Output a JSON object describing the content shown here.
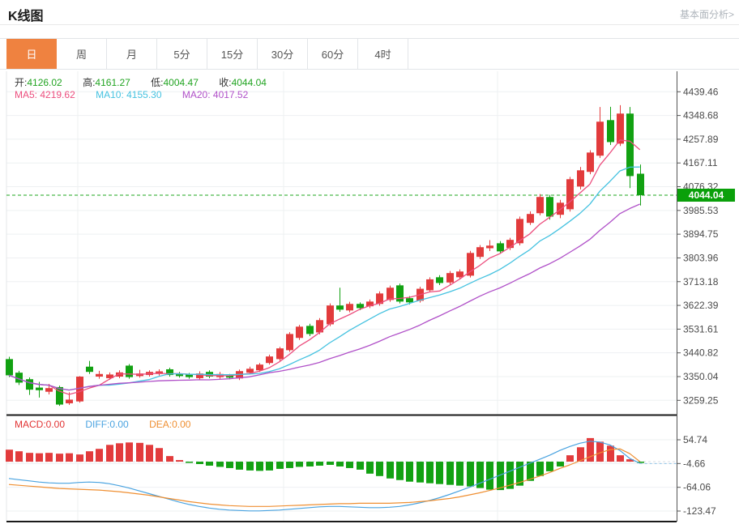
{
  "header": {
    "title": "K线图",
    "link_label": "基本面分析>"
  },
  "tabs": {
    "items": [
      "日",
      "周",
      "月",
      "5分",
      "15分",
      "30分",
      "60分",
      "4时"
    ],
    "active_index": 0
  },
  "ohlc": [
    {
      "label": "开:",
      "value": "4126.02"
    },
    {
      "label": "高:",
      "value": "4161.27"
    },
    {
      "label": "低:",
      "value": "4004.47"
    },
    {
      "label": "收:",
      "value": "4044.04"
    }
  ],
  "ma_legend": [
    {
      "label": "MA5:",
      "value": "4219.62"
    },
    {
      "label": "MA10:",
      "value": "4155.30"
    },
    {
      "label": "MA20:",
      "value": "4017.52"
    }
  ],
  "macd_legend": [
    {
      "label": "MACD:",
      "value": "0.00"
    },
    {
      "label": "DIFF:",
      "value": "0.00"
    },
    {
      "label": "DEA:",
      "value": "0.00"
    }
  ],
  "current_price_label": "4044.04",
  "colors": {
    "up": "#e23b3c",
    "down": "#12a112",
    "ma5": "#ec4e7e",
    "ma10": "#45c2e0",
    "ma20": "#b050c8",
    "diff": "#4aa3e0",
    "dea": "#ef8f32",
    "tab_active": "#ef8240",
    "price_badge": "#0aa00a",
    "grid": "#eef0f2",
    "axis": "#555555",
    "axis_label": "#4a4a4a",
    "price_line": "#1ea51e",
    "dark_rule": "#1a1a1a"
  },
  "chart_data": {
    "type": "candlestick",
    "title": "K线图",
    "period": "日",
    "legend_position": "top-left",
    "grid": true,
    "y_axis_ticks": [
      4439.46,
      4348.68,
      4257.89,
      4167.11,
      4076.32,
      3985.53,
      3894.75,
      3803.96,
      3713.18,
      3622.39,
      3531.61,
      3440.82,
      3350.04,
      3259.25
    ],
    "current_price": 4044.04,
    "ma_periods": [
      5,
      10,
      20
    ],
    "candles": [
      [
        3417,
        3426,
        3348,
        3355
      ],
      [
        3365,
        3372,
        3318,
        3327
      ],
      [
        3340,
        3347,
        3280,
        3300
      ],
      [
        3308,
        3330,
        3270,
        3298
      ],
      [
        3292,
        3322,
        3282,
        3306
      ],
      [
        3310,
        3315,
        3238,
        3243
      ],
      [
        3248,
        3290,
        3242,
        3262
      ],
      [
        3255,
        3352,
        3250,
        3350
      ],
      [
        3388,
        3410,
        3360,
        3368
      ],
      [
        3350,
        3372,
        3342,
        3360
      ],
      [
        3344,
        3366,
        3338,
        3358
      ],
      [
        3350,
        3374,
        3344,
        3366
      ],
      [
        3392,
        3398,
        3342,
        3348
      ],
      [
        3352,
        3376,
        3346,
        3362
      ],
      [
        3356,
        3374,
        3350,
        3368
      ],
      [
        3360,
        3378,
        3354,
        3370
      ],
      [
        3378,
        3384,
        3350,
        3356
      ],
      [
        3362,
        3368,
        3346,
        3352
      ],
      [
        3358,
        3364,
        3342,
        3348
      ],
      [
        3344,
        3370,
        3338,
        3362
      ],
      [
        3368,
        3374,
        3344,
        3350
      ],
      [
        3348,
        3368,
        3342,
        3360
      ],
      [
        3354,
        3360,
        3340,
        3346
      ],
      [
        3343,
        3377,
        3337,
        3371
      ],
      [
        3365,
        3388,
        3358,
        3380
      ],
      [
        3374,
        3402,
        3368,
        3396
      ],
      [
        3402,
        3434,
        3396,
        3427
      ],
      [
        3417,
        3464,
        3410,
        3458
      ],
      [
        3451,
        3520,
        3445,
        3513
      ],
      [
        3498,
        3548,
        3490,
        3541
      ],
      [
        3544,
        3552,
        3505,
        3513
      ],
      [
        3519,
        3574,
        3512,
        3566
      ],
      [
        3550,
        3630,
        3543,
        3622
      ],
      [
        3622,
        3690,
        3598,
        3606
      ],
      [
        3603,
        3636,
        3596,
        3628
      ],
      [
        3628,
        3634,
        3604,
        3612
      ],
      [
        3619,
        3645,
        3612,
        3637
      ],
      [
        3628,
        3676,
        3621,
        3668
      ],
      [
        3643,
        3698,
        3636,
        3690
      ],
      [
        3699,
        3706,
        3630,
        3637
      ],
      [
        3650,
        3658,
        3626,
        3634
      ],
      [
        3640,
        3694,
        3633,
        3686
      ],
      [
        3680,
        3730,
        3672,
        3722
      ],
      [
        3730,
        3738,
        3700,
        3708
      ],
      [
        3710,
        3754,
        3702,
        3746
      ],
      [
        3730,
        3760,
        3722,
        3752
      ],
      [
        3736,
        3831,
        3729,
        3823
      ],
      [
        3808,
        3853,
        3800,
        3845
      ],
      [
        3841,
        3872,
        3830,
        3851
      ],
      [
        3860,
        3868,
        3820,
        3829
      ],
      [
        3842,
        3881,
        3834,
        3873
      ],
      [
        3860,
        3962,
        3852,
        3953
      ],
      [
        3938,
        3982,
        3930,
        3972
      ],
      [
        3975,
        4048,
        3967,
        4037
      ],
      [
        4037,
        4045,
        3950,
        3962
      ],
      [
        3969,
        4026,
        3956,
        4015
      ],
      [
        3990,
        4114,
        3981,
        4105
      ],
      [
        4077,
        4152,
        4066,
        4139
      ],
      [
        4133,
        4216,
        4124,
        4207
      ],
      [
        4195,
        4381,
        4186,
        4325
      ],
      [
        4331,
        4382,
        4236,
        4247
      ],
      [
        4241,
        4388,
        4232,
        4356
      ],
      [
        4356,
        4381,
        4071,
        4117
      ],
      [
        4126.02,
        4161.27,
        4004.47,
        4044.04
      ]
    ],
    "macd": {
      "ticks": [
        54.74,
        -4.66,
        -64.06,
        -123.47
      ],
      "histogram": [
        30,
        26,
        22,
        21,
        22,
        20,
        21,
        18,
        26,
        32,
        42,
        46,
        48,
        47,
        42,
        34,
        14,
        4,
        -3,
        -6,
        -10,
        -13,
        -16,
        -20,
        -22,
        -23,
        -22,
        -18,
        -16,
        -13,
        -12,
        -10,
        -8,
        -12,
        -16,
        -20,
        -30,
        -36,
        -42,
        -46,
        -50,
        -52,
        -54,
        -56,
        -58,
        -60,
        -62,
        -66,
        -70,
        -71,
        -68,
        -60,
        -48,
        -36,
        -24,
        -12,
        16,
        36,
        59,
        50,
        40,
        16,
        6,
        -1
      ],
      "diff": [
        -42,
        -45,
        -48,
        -51,
        -53,
        -54,
        -54,
        -52,
        -51,
        -52,
        -55,
        -60,
        -66,
        -73,
        -80,
        -87,
        -94,
        -101,
        -107,
        -112,
        -116,
        -119,
        -121,
        -122,
        -123,
        -123,
        -122,
        -121,
        -119,
        -117,
        -115,
        -113,
        -112,
        -112,
        -113,
        -114,
        -115,
        -115,
        -114,
        -112,
        -108,
        -103,
        -97,
        -90,
        -82,
        -73,
        -64,
        -54,
        -44,
        -34,
        -24,
        -14,
        -4,
        6,
        16,
        28,
        38,
        46,
        51,
        49,
        42,
        28,
        8,
        -4
      ],
      "dea": [
        -57,
        -59,
        -61,
        -63,
        -65,
        -67,
        -68,
        -69,
        -70,
        -71,
        -73,
        -75,
        -78,
        -81,
        -84,
        -88,
        -92,
        -96,
        -100,
        -103,
        -106,
        -108,
        -110,
        -111,
        -112,
        -112,
        -112,
        -111,
        -110,
        -109,
        -108,
        -107,
        -106,
        -105,
        -105,
        -104,
        -104,
        -104,
        -104,
        -103,
        -102,
        -100,
        -98,
        -95,
        -92,
        -88,
        -83,
        -78,
        -72,
        -66,
        -59,
        -52,
        -44,
        -36,
        -27,
        -17,
        -8,
        2,
        12,
        22,
        30,
        32,
        20,
        0
      ]
    }
  }
}
